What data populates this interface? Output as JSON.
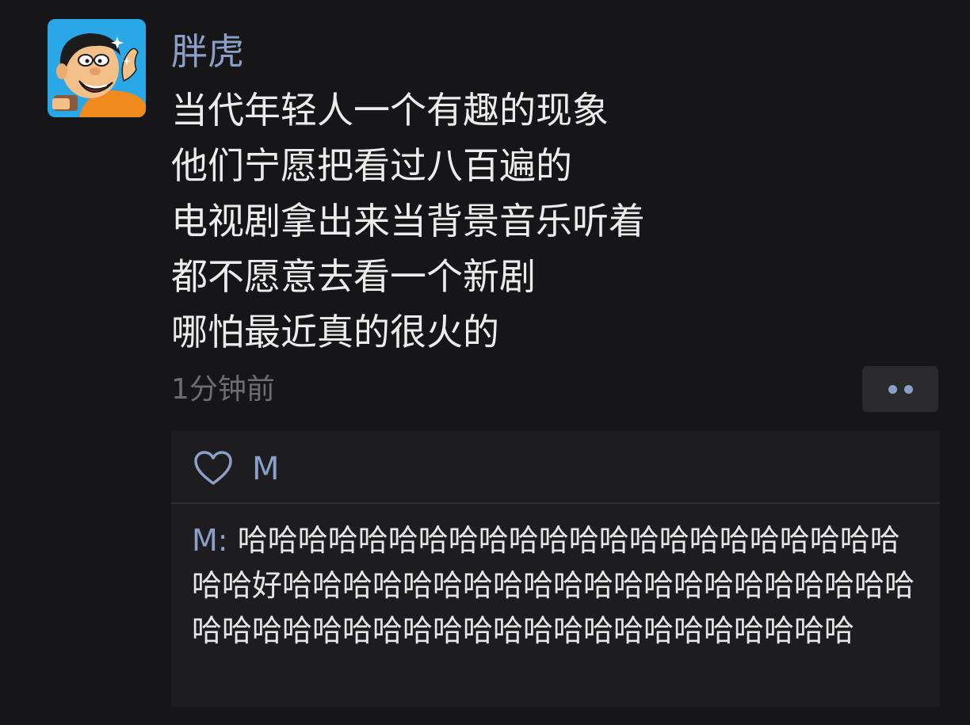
{
  "post": {
    "username": "胖虎",
    "content_lines": [
      "当代年轻人一个有趣的现象",
      "他们宁愿把看过八百遍的",
      "电视剧拿出来当背景音乐听着",
      "都不愿意去看一个新剧",
      "哪怕最近真的很火的"
    ],
    "timestamp": "1分钟前",
    "more_icon": "more-dots-icon"
  },
  "interactions": {
    "like_icon": "heart-icon",
    "liker": "M",
    "comment": {
      "author": "M",
      "separator": ": ",
      "text": "哈哈哈哈哈哈哈哈哈哈哈哈哈哈哈哈哈哈哈哈哈哈哈哈好哈哈哈哈哈哈哈哈哈哈哈哈哈哈哈哈哈哈哈哈哈哈哈哈哈哈哈哈哈哈哈哈哈哈哈哈哈哈哈哈哈哈哈"
    }
  },
  "colors": {
    "background": "#161618",
    "panel": "#1d1d20",
    "name_blue": "#8aa0c6",
    "text": "#ececec",
    "muted": "#6d6d70"
  }
}
